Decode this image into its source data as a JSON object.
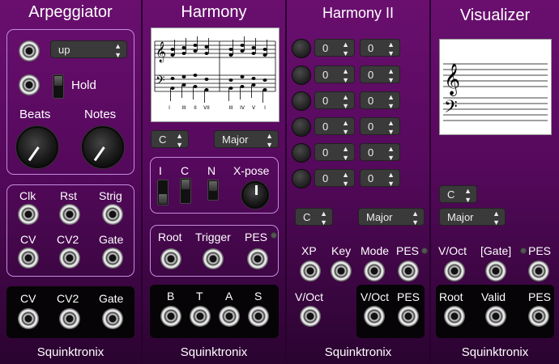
{
  "arp": {
    "title": "Arpeggiator",
    "mode": "up",
    "hold": "Hold",
    "beats": "Beats",
    "notes": "Notes",
    "inputs": [
      "Clk",
      "Rst",
      "Strig",
      "CV",
      "CV2",
      "Gate"
    ],
    "outputs": [
      "CV",
      "CV2",
      "Gate"
    ],
    "brand": "Squinktronix"
  },
  "harm": {
    "title": "Harmony",
    "key": "C",
    "mode": "Major",
    "toggles": [
      "I",
      "C",
      "N"
    ],
    "xpose": "X-pose",
    "io": [
      "Root",
      "Trigger",
      "PES"
    ],
    "voices": [
      "B",
      "T",
      "A",
      "S"
    ],
    "brand": "Squinktronix",
    "numerals": [
      "I",
      "III",
      "II",
      "VII",
      "",
      "III",
      "IV",
      "V",
      "I"
    ]
  },
  "harm2": {
    "title": "Harmony II",
    "transpose": [
      [
        "0",
        "0"
      ],
      [
        "0",
        "0"
      ],
      [
        "0",
        "0"
      ],
      [
        "0",
        "0"
      ],
      [
        "0",
        "0"
      ],
      [
        "0",
        "0"
      ]
    ],
    "key": "C",
    "mode": "Major",
    "jacks": [
      "XP",
      "Key",
      "Mode",
      "PES"
    ],
    "voct": "V/Oct",
    "outs": [
      "V/Oct",
      "PES"
    ],
    "brand": "Squinktronix"
  },
  "vis": {
    "title": "Visualizer",
    "key": "C",
    "mode": "Major",
    "io": [
      "V/Oct",
      "[Gate]",
      "PES"
    ],
    "outs": [
      "Root",
      "Valid",
      "PES"
    ],
    "brand": "Squinktronix"
  },
  "colors": {
    "panel": "#5a0a60",
    "frame": "#c58be0",
    "dark": "#060406"
  }
}
